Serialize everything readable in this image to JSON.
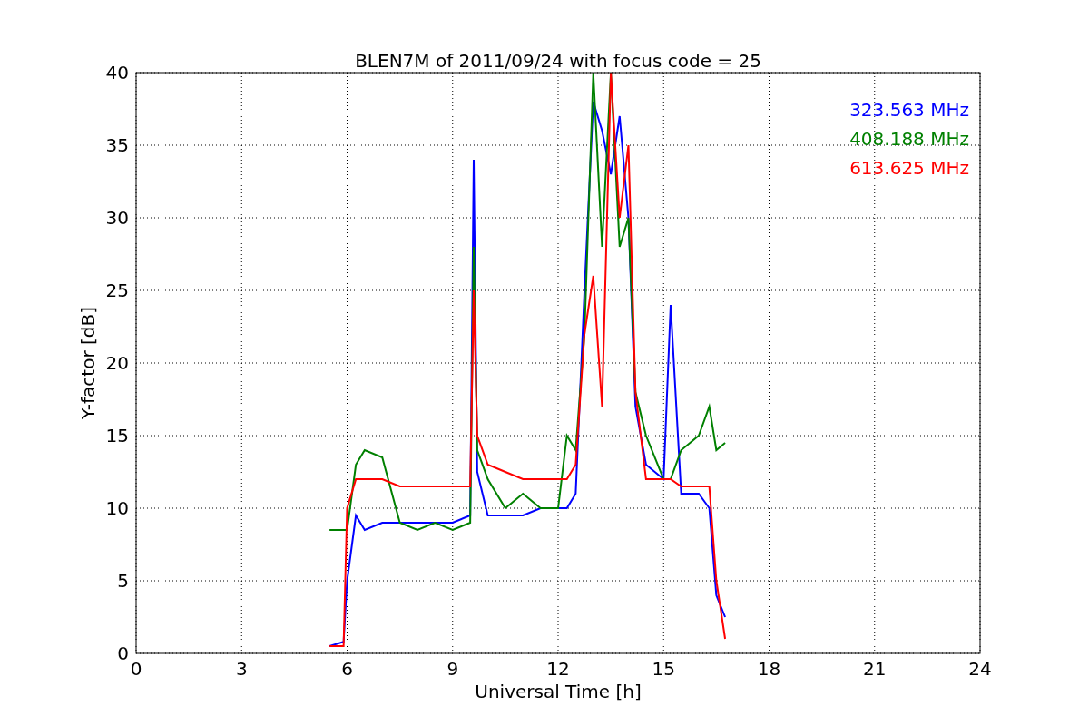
{
  "chart_data": {
    "type": "line",
    "title": "BLEN7M of 2011/09/24 with focus code = 25",
    "xlabel": "Universal Time [h]",
    "ylabel": "Y-factor [dB]",
    "x": [
      5.5,
      5.9,
      6,
      6.25,
      6.5,
      7,
      7.5,
      8,
      8.5,
      9,
      9.5,
      9.6,
      9.7,
      10,
      10.5,
      11,
      11.5,
      12,
      12.25,
      12.5,
      12.75,
      13,
      13.25,
      13.5,
      13.75,
      14,
      14.2,
      14.5,
      15,
      15.2,
      15.5,
      16,
      16.3,
      16.5,
      16.75
    ],
    "series": [
      {
        "name": "323.563 MHz",
        "color": "#0000ff",
        "values": [
          0.5,
          0.8,
          5,
          9.5,
          8.5,
          9,
          9,
          9,
          9,
          9,
          9.5,
          34,
          12.5,
          9.5,
          9.5,
          9.5,
          10,
          10,
          10,
          11,
          25,
          38,
          36,
          33,
          37,
          30,
          17,
          13,
          12,
          24,
          11,
          11,
          10,
          4,
          2.5
        ]
      },
      {
        "name": "408.188 MHz",
        "color": "#008000",
        "values": [
          8.5,
          8.5,
          8.5,
          13,
          14,
          13.5,
          9,
          8.5,
          9,
          8.5,
          9,
          28,
          14,
          12,
          10,
          11,
          10,
          10,
          15,
          14,
          22,
          40,
          28,
          40,
          28,
          30,
          18,
          15,
          12,
          12,
          14,
          15,
          17,
          14,
          14.5
        ]
      },
      {
        "name": "613.625 MHz",
        "color": "#ff0000",
        "values": [
          0.5,
          0.5,
          10,
          12,
          12,
          12,
          11.5,
          11.5,
          11.5,
          11.5,
          11.5,
          25,
          15,
          13,
          12.5,
          12,
          12,
          12,
          12,
          13,
          22,
          26,
          17,
          40,
          30,
          35,
          18,
          12,
          12,
          12,
          11.5,
          11.5,
          11.5,
          5,
          1
        ]
      }
    ],
    "grid": true,
    "xlim": [
      0,
      24
    ],
    "ylim": [
      0,
      40
    ],
    "xticks": [
      0,
      3,
      6,
      9,
      12,
      15,
      18,
      21,
      24
    ],
    "yticks": [
      0,
      5,
      10,
      15,
      20,
      25,
      30,
      35,
      40
    ]
  }
}
